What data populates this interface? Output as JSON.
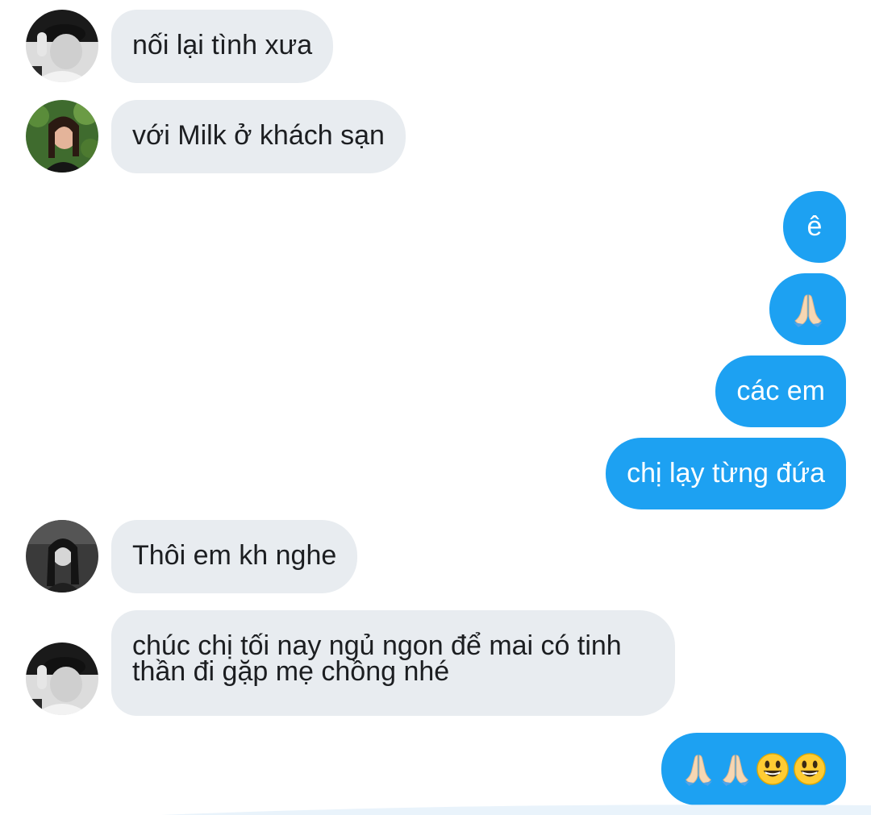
{
  "messages": [
    {
      "side": "in",
      "avatar": "avatar-man-cap",
      "text": "nối lại tình xưa"
    },
    {
      "side": "in",
      "avatar": "avatar-woman-green",
      "text": "với Milk ở khách sạn"
    },
    {
      "side": "out",
      "text": "ê"
    },
    {
      "side": "out",
      "emoji": [
        "folded-hands"
      ]
    },
    {
      "side": "out",
      "text": "các em"
    },
    {
      "side": "out",
      "text": "chị lạy từng đứa"
    },
    {
      "side": "in",
      "avatar": "avatar-woman-bw",
      "text": "Thôi em kh nghe"
    },
    {
      "side": "in",
      "avatar": "avatar-man-cap",
      "text_line1": "chúc chị tối nay ngủ ngon để mai có tinh",
      "text_line2": "thần đi gặp mẹ chồng nhé"
    },
    {
      "side": "out",
      "emoji": [
        "folded-hands",
        "folded-hands",
        "smiling-face",
        "smiling-face"
      ]
    }
  ],
  "colors": {
    "outgoing_bubble": "#1da1f2",
    "incoming_bubble": "#e8ecf0",
    "incoming_text": "#1c1e21",
    "outgoing_text": "#ffffff"
  }
}
